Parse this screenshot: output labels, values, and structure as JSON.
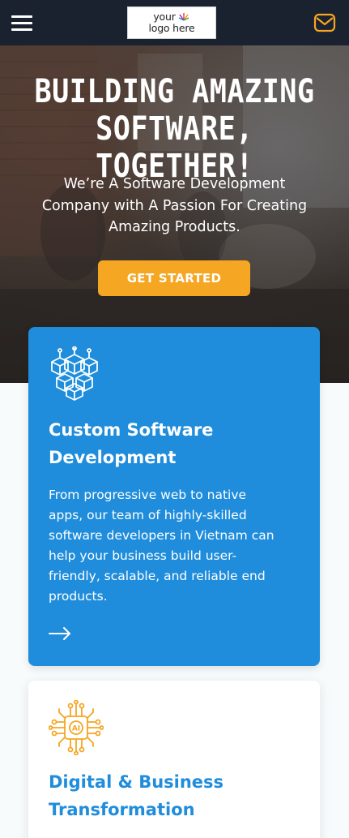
{
  "header": {
    "logo_line1": "your",
    "logo_line2": "logo here",
    "menu_icon": "hamburger-menu-icon",
    "mail_icon": "mail-envelope-icon"
  },
  "hero": {
    "title_line1": "BUILDING AMAZING",
    "title_line2": "SOFTWARE, TOGETHER!",
    "subtitle_line1": "We’re A Software Development",
    "subtitle_line2": "Company with A Passion For Creating",
    "subtitle_line3": "Amazing Products.",
    "cta_label": "GET STARTED"
  },
  "services": [
    {
      "icon": "cubes-network-icon",
      "title_line1": "Custom Software",
      "title_line2": "Development",
      "desc_line1": "From progressive web to native",
      "desc_line2": "apps, our team of highly-skilled",
      "desc_line3": "software developers in Vietnam can",
      "desc_line4": "help your business build user-",
      "desc_line5": "friendly, scalable, and reliable end",
      "desc_line6": "products.",
      "arrow_icon": "arrow-right-icon"
    },
    {
      "icon": "ai-chip-icon",
      "icon_text": "AI",
      "title_line1": "Digital & Business",
      "title_line2": "Transformation"
    }
  ],
  "colors": {
    "topbar": "#1a2230",
    "accent_orange": "#f5a623",
    "card_blue": "#1f8ddb",
    "page_bg": "#f7fbfc"
  }
}
